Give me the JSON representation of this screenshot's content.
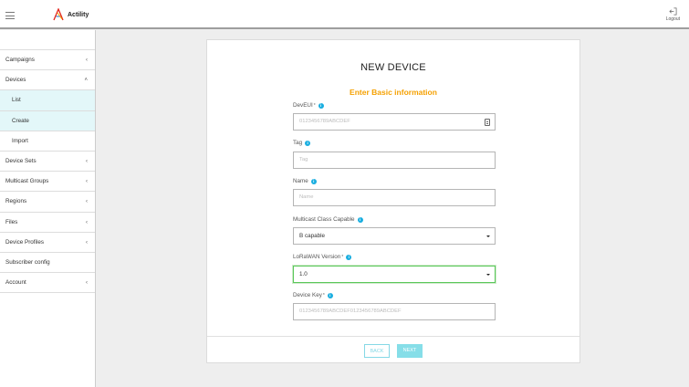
{
  "header": {
    "brand": "Actility",
    "logout_label": "Logout"
  },
  "sidebar": {
    "items": [
      {
        "label": "Campaigns"
      },
      {
        "label": "Devices"
      },
      {
        "label": "List"
      },
      {
        "label": "Create"
      },
      {
        "label": "Import"
      },
      {
        "label": "Device Sets"
      },
      {
        "label": "Multicast Groups"
      },
      {
        "label": "Regions"
      },
      {
        "label": "Files"
      },
      {
        "label": "Device Profiles"
      },
      {
        "label": "Subscriber config"
      },
      {
        "label": "Account"
      }
    ]
  },
  "form": {
    "title": "NEW DEVICE",
    "subtitle": "Enter Basic information",
    "deveui": {
      "label": "DevEUI",
      "placeholder": "0123456789ABCDEF"
    },
    "tag": {
      "label": "Tag",
      "placeholder": "Tag"
    },
    "name": {
      "label": "Name",
      "placeholder": "Name"
    },
    "multicast": {
      "label": "Multicast Class Capable",
      "value": "B capable"
    },
    "lorawan": {
      "label": "LoRaWAN Version",
      "value": "1.0"
    },
    "devicekey": {
      "label": "Device Key",
      "placeholder": "0123456789ABCDEF0123456789ABCDEF"
    },
    "required_mark": "*",
    "back_label": "BACK",
    "next_label": "NEXT"
  },
  "colors": {
    "accent_orange": "#f5a000",
    "active_item_bg": "#e3f7f9",
    "info_icon": "#19aee0",
    "focus_green": "#5ac85a",
    "button_teal": "#86dee8"
  },
  "icons": {
    "menu": "hamburger-icon",
    "logo": "actility-logo-icon",
    "logout": "logout-icon",
    "chevron_collapsed": "chevron-left-icon",
    "chevron_expanded": "chevron-up-icon",
    "info": "info-icon",
    "clipboard": "clipboard-icon",
    "dropdown": "caret-down-icon"
  }
}
